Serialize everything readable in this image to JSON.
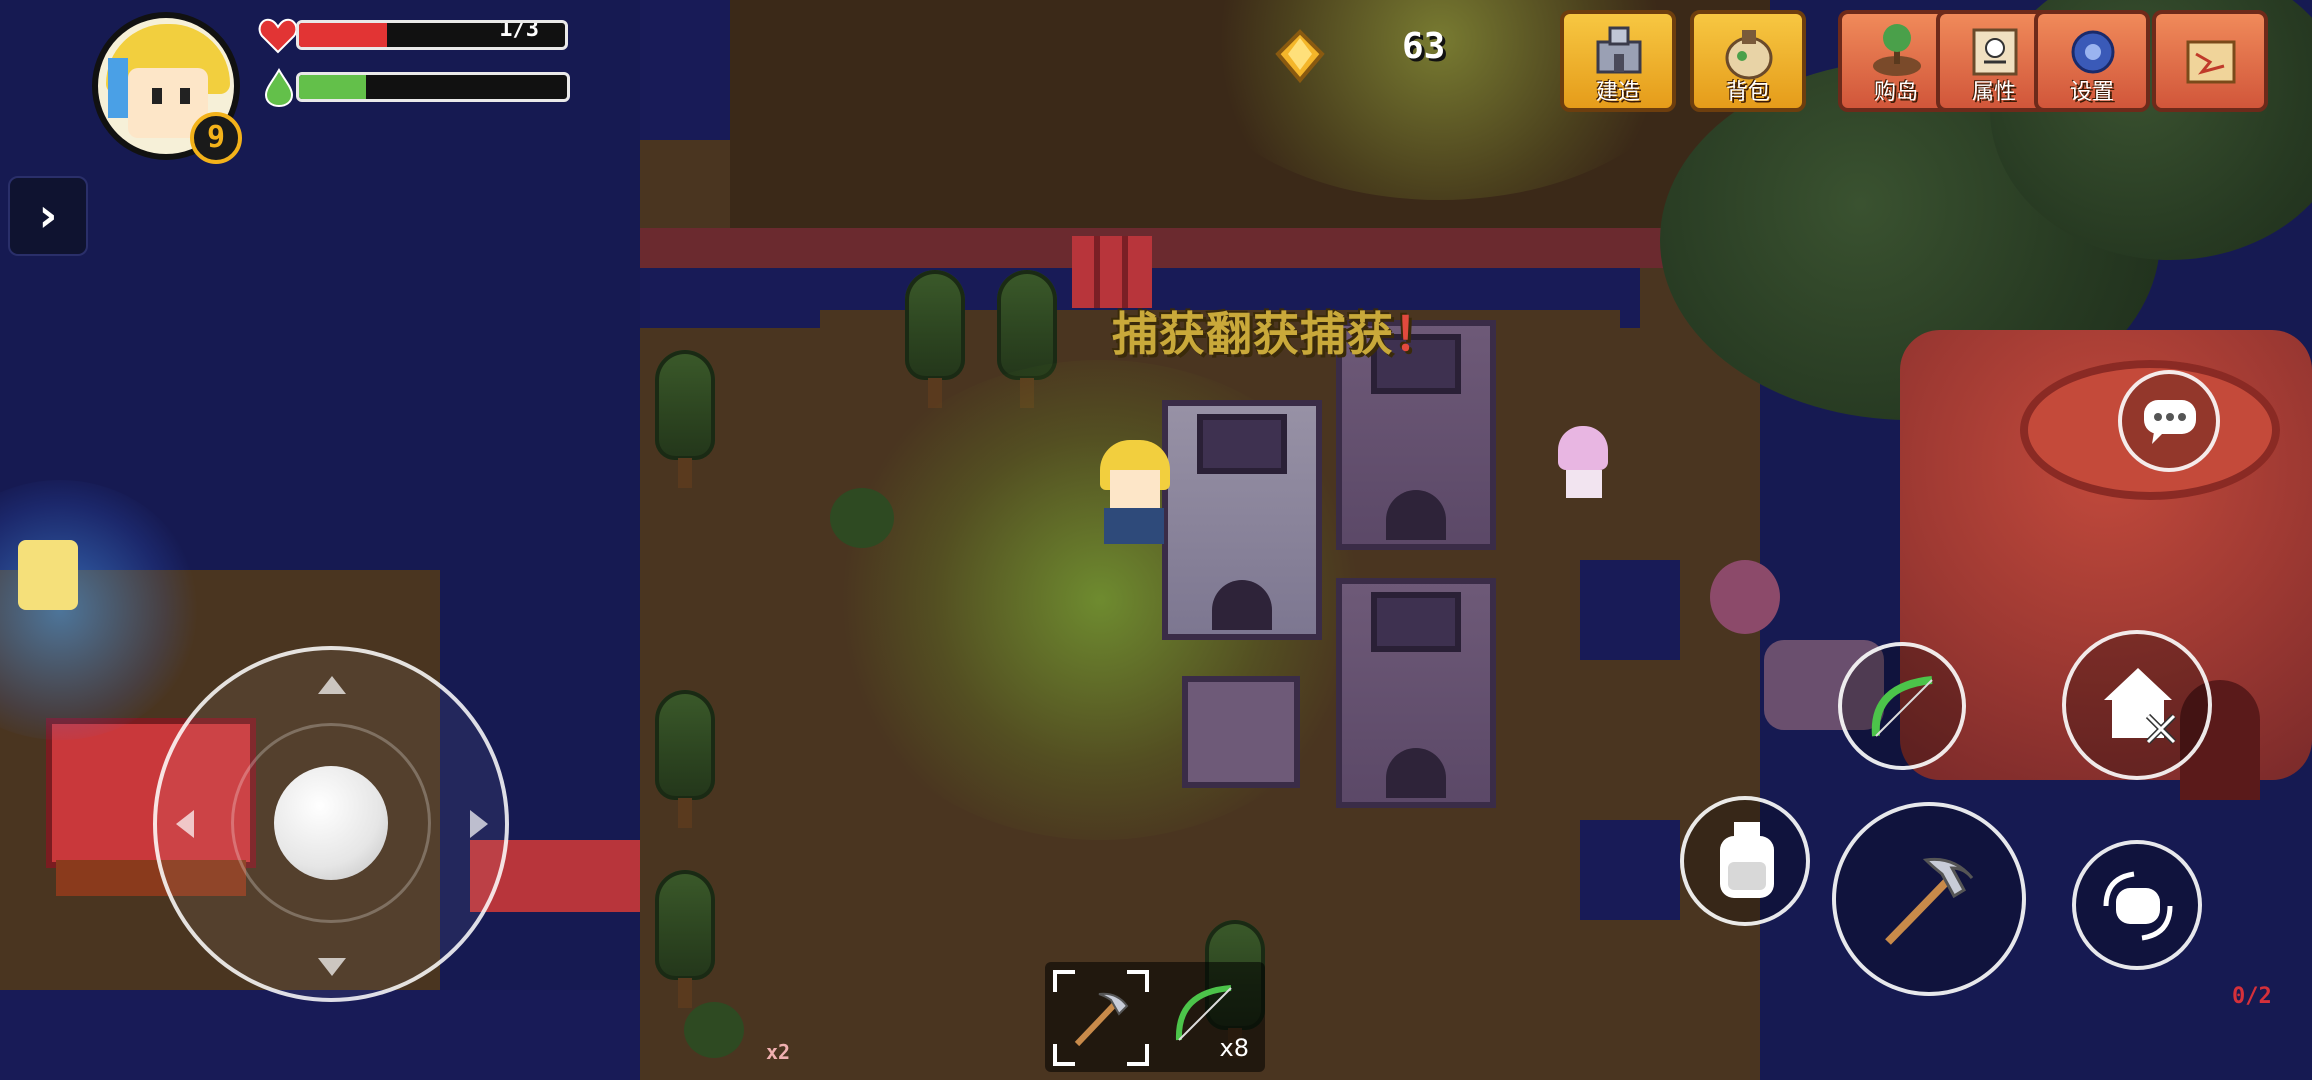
{
  "player": {
    "level": "9",
    "hp_text": "1/3",
    "hp_fraction": 0.33,
    "energy_fraction": 0.25
  },
  "currency": {
    "coin_count": "63"
  },
  "top_menu": [
    {
      "label": "建造",
      "icon": "build-icon"
    },
    {
      "label": "背包",
      "icon": "backpack-icon"
    },
    {
      "label": "购岛",
      "icon": "buy-island-icon"
    },
    {
      "label": "属性",
      "icon": "attributes-icon"
    },
    {
      "label": "设置",
      "icon": "settings-gear-icon"
    },
    {
      "label": "",
      "icon": "map-scroll-icon"
    }
  ],
  "notification": {
    "text_prefix": "捕获",
    "text_overlap": "翻获捕获",
    "text_suffix": "！"
  },
  "hotbar": {
    "slots": [
      {
        "icon": "pickaxe-icon",
        "count": ""
      },
      {
        "icon": "bow-icon",
        "count": "x8"
      }
    ]
  },
  "world_labels": {
    "item_x2": "x2",
    "corner_counter": "0/2"
  },
  "colors": {
    "hp": "#e23434",
    "energy": "#63c04a",
    "button": "#f2b62c",
    "accent_badge": "#f3b21a"
  }
}
